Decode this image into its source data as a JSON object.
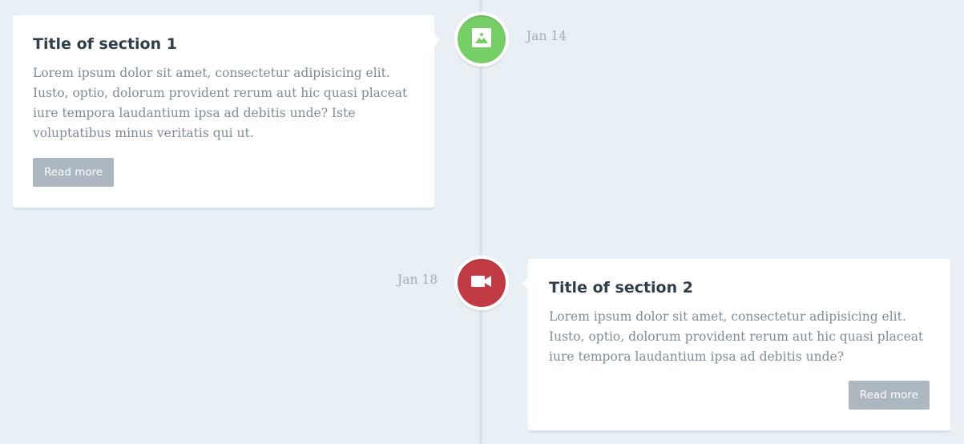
{
  "timeline": {
    "items": [
      {
        "title": "Title of section 1",
        "text": "Lorem ipsum dolor sit amet, consectetur adipisicing elit. Iusto, optio, dolorum provident rerum aut hic quasi placeat iure tempora laudantium ipsa ad debitis unde? Iste voluptatibus minus veritatis qui ut.",
        "button_label": "Read more",
        "date": "Jan 14",
        "icon": "picture-icon",
        "marker_color": "#75ce66"
      },
      {
        "title": "Title of section 2",
        "text": "Lorem ipsum dolor sit amet, consectetur adipisicing elit. Iusto, optio, dolorum provident rerum aut hic quasi placeat iure tempora laudantium ipsa ad debitis unde?",
        "button_label": "Read more",
        "date": "Jan 18",
        "icon": "video-camera-icon",
        "marker_color": "#c03b44"
      }
    ]
  },
  "colors": {
    "background": "#e9f0f5",
    "line": "#d7e4ed",
    "card": "#ffffff",
    "title": "#303e49",
    "text": "#7f8c97",
    "button": "#acb7c0",
    "date": "#a2adb6"
  }
}
